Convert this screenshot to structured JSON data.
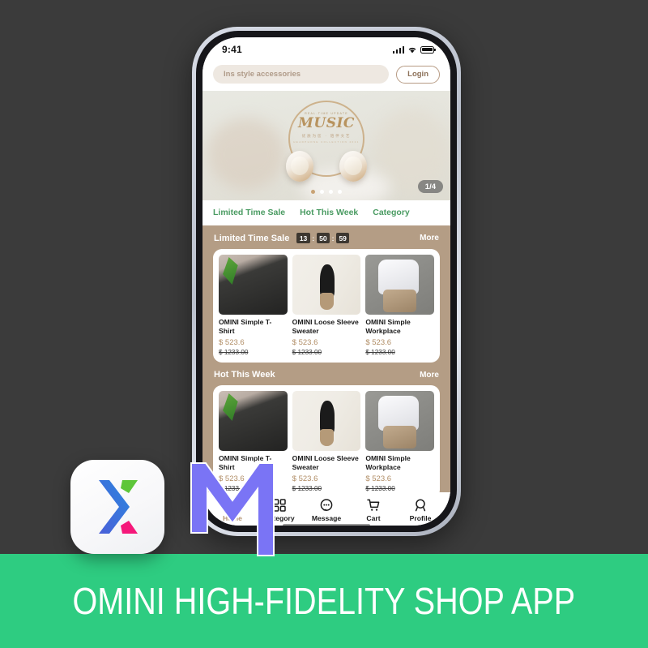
{
  "banner": {
    "title": "OMINI HIGH-FIDELITY SHOP APP",
    "background_color": "#2ecc81",
    "text_color": "#ffffff"
  },
  "backdrop": {
    "color": "#3b3b3b"
  },
  "logos": {
    "app_icon_name": "omini-app-icon",
    "app_icon_glyph": "X",
    "app_icon_colors": [
      "#3b6fe0",
      "#1e9be0",
      "#5ec63a",
      "#f5187a"
    ],
    "m_logo_name": "m-letter-logo",
    "m_logo_color": "#7a74f5"
  },
  "phone": {
    "statusbar": {
      "time": "9:41",
      "signal_icon": "signal-bars-icon",
      "wifi_icon": "wifi-icon",
      "battery_icon": "battery-icon"
    },
    "search": {
      "placeholder": "Ins style accessories",
      "value": "",
      "login_label": "Login"
    },
    "carousel": {
      "kicker": "REAL-TIME UPDATE",
      "word": "MUSIC",
      "subtitle": "优质为您 · 陪伴文艺",
      "subtitle2": "HEADPHONE COLLECTION 2021",
      "page_badge": "1/4",
      "dot_count": 4,
      "active_dot": 1,
      "active_dot_color": "#c8a274"
    },
    "tabs": [
      {
        "label": "Limited Time Sale"
      },
      {
        "label": "Hot This Week"
      },
      {
        "label": "Category"
      }
    ],
    "tab_color": "#4a9b62",
    "sections": [
      {
        "title": "Limited Time Sale",
        "more_label": "More",
        "countdown": {
          "hours": "13",
          "minutes": "50",
          "seconds": "59",
          "separator": ":"
        },
        "products": [
          {
            "name": "OMINI Simple T-Shirt",
            "price": "$ 523.6",
            "old_price": "$ 1233.00",
            "image": "black-tshirt-photo"
          },
          {
            "name": "OMINI Loose Sleeve Sweater",
            "price": "$ 523.6",
            "old_price": "$ 1233.00",
            "image": "black-sweater-photo"
          },
          {
            "name": "OMINI Simple Workplace",
            "price": "$ 523.6",
            "old_price": "$ 1233.00",
            "image": "white-shirt-photo"
          }
        ]
      },
      {
        "title": "Hot This Week",
        "more_label": "More",
        "countdown": null,
        "products": [
          {
            "name": "OMINI Simple T-Shirt",
            "price": "$ 523.6",
            "old_price": "$ 1233.00",
            "image": "black-tshirt-photo"
          },
          {
            "name": "OMINI Loose Sleeve Sweater",
            "price": "$ 523.6",
            "old_price": "$ 1233.00",
            "image": "black-sweater-photo"
          },
          {
            "name": "OMINI Simple Workplace",
            "price": "$ 523.6",
            "old_price": "$ 1233.00",
            "image": "white-shirt-photo"
          }
        ]
      }
    ],
    "section_bg_color": "#b49d85",
    "bottom_nav": [
      {
        "label": "Home",
        "icon": "home-icon",
        "active": true
      },
      {
        "label": "Category",
        "icon": "grid-icon",
        "active": false
      },
      {
        "label": "Message",
        "icon": "message-icon",
        "active": false
      },
      {
        "label": "Cart",
        "icon": "cart-icon",
        "active": false
      },
      {
        "label": "Profile",
        "icon": "profile-icon",
        "active": false
      }
    ],
    "active_nav_color": "#b49472"
  }
}
